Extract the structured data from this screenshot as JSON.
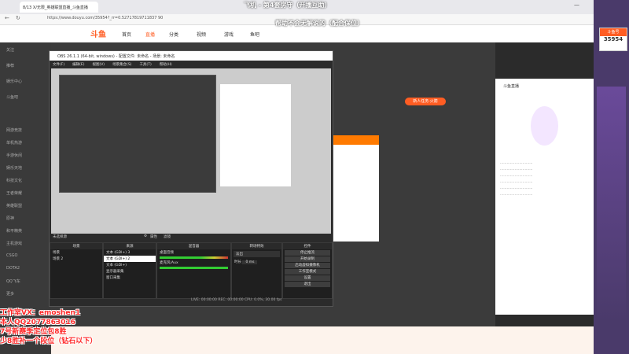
{
  "overlay_top": {
    "line1": "飞机 - 第4套房守（开播互助）",
    "line2": "帮助不会无解说的（配合保位）"
  },
  "browser": {
    "tab_title": "8/13 X/无限_英雄联盟直播_斗鱼直播",
    "url": "https://www.douyu.com/35954?_rr=0.52717819711837 90"
  },
  "site": {
    "logo": "斗鱼",
    "nav": [
      "首页",
      "直播",
      "分类",
      "视频",
      "游戏",
      "鱼吧"
    ],
    "side_items": [
      "关注",
      "推荐",
      "娱乐中心",
      "斗鱼吧",
      "网游竞技",
      "单机热游",
      "手游休闲",
      "娱乐天地",
      "科技文化",
      "王者荣耀",
      "英雄联盟",
      "原神",
      "和平精英",
      "主机游戏",
      "CSGO",
      "DOTA2",
      "QQ飞车",
      "更多"
    ],
    "badge_name": "斗鱼号",
    "badge_num": "35954",
    "right_panel_title": "斗鱼直播",
    "task_label": "新人任务·火箭"
  },
  "obs": {
    "title": "OBS 26.1.1 (64-bit, windows) - 配置文件: 未命名 - 场景: 未命名",
    "menu": [
      "文件(F)",
      "编辑(E)",
      "视图(V)",
      "场景集合(S)",
      "工具(T)",
      "帮助(H)"
    ],
    "no_source": "未选择源",
    "properties": "属性",
    "filters": "滤镜",
    "dock_scenes": "场景",
    "dock_sources": "来源",
    "dock_mixer": "混音器",
    "dock_transitions": "转场特效",
    "dock_controls": "控件",
    "scenes": [
      "场景",
      "场景 2"
    ],
    "sources": [
      "文本 (GDI+) 3",
      "文本 (GDI+) 2",
      "文本 (GDI+)",
      "显示器采集",
      "窗口采集"
    ],
    "mixer_items": [
      "桌面音频",
      "麦克风/Aux"
    ],
    "transition_name": "淡出",
    "duration_label": "时长",
    "duration_value": "0 ms",
    "controls": [
      "停止推流",
      "开始录制",
      "启动虚拟摄像机",
      "工作室模式",
      "设置",
      "退出"
    ],
    "status": "LIVE: 00:00:00   REC: 00:00:00   CPU: 0.0%, 30.00 fps"
  },
  "overlay_bottom": {
    "line1": "工作室VX：emoshen1",
    "line2": "本人QQ2077863016",
    "line3": "7号新赛季定位包8胜",
    "line4": "少8胜补一个段位（钻石以下）"
  },
  "colors": {
    "accent": "#ff5d23",
    "red_text": "#ff2a2a",
    "obs_bg": "#2b2b2b"
  }
}
